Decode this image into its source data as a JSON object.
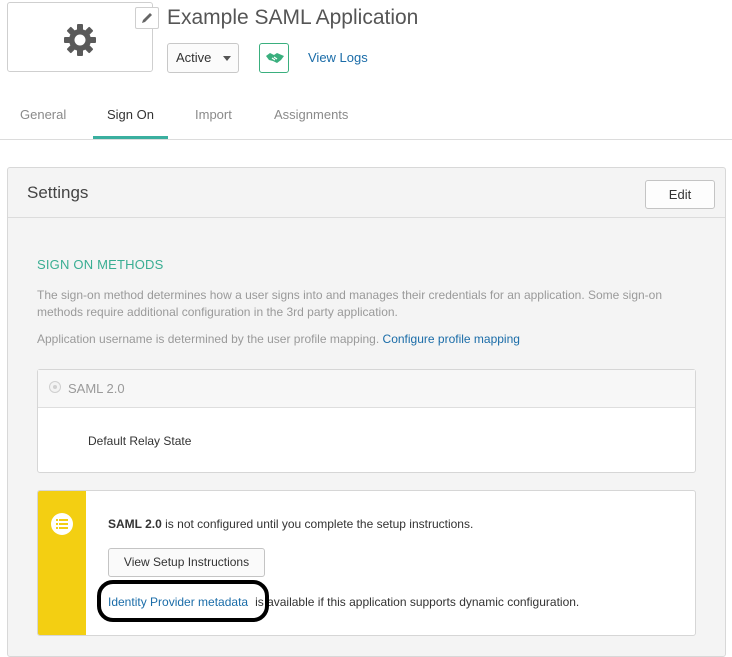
{
  "header": {
    "app_title": "Example SAML Application",
    "status_value": "Active",
    "view_logs_label": "View Logs"
  },
  "tabs": [
    {
      "label": "General"
    },
    {
      "label": "Sign On"
    },
    {
      "label": "Import"
    },
    {
      "label": "Assignments"
    }
  ],
  "settings": {
    "title": "Settings",
    "edit_label": "Edit",
    "section_title": "SIGN ON METHODS",
    "description": "The sign-on method determines how a user signs into and manages their credentials for an application. Some sign-on methods require additional configuration in the 3rd party application.",
    "username_text": "Application username is determined by the user profile mapping.",
    "profile_mapping_link": "Configure profile mapping",
    "saml_label": "SAML 2.0",
    "relay_state_label": "Default Relay State"
  },
  "notice": {
    "strong": "SAML 2.0",
    "text": "is not configured until you complete the setup instructions.",
    "setup_button": "View Setup Instructions",
    "idp_link": "Identity Provider metadata",
    "idp_text": "is available if this application supports dynamic configuration."
  },
  "colors": {
    "accent_green": "#3aaf9f",
    "link_blue": "#1a6ca8",
    "notice_yellow": "#f3cf12"
  },
  "icons": [
    "gear-icon",
    "pencil-icon",
    "handshake-icon",
    "list-icon",
    "chevron-down-icon"
  ]
}
